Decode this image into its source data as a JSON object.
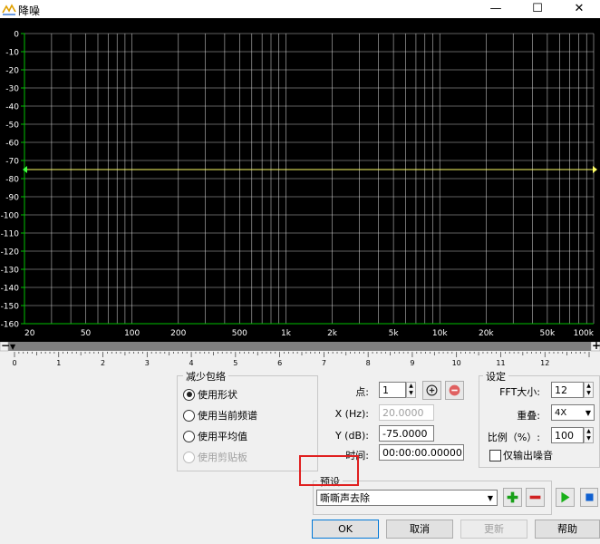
{
  "window": {
    "title": "降噪",
    "minimize": "—",
    "maximize": "☐",
    "close": "✕"
  },
  "chart_data": {
    "type": "line",
    "x_tick_labels": [
      "20",
      "50",
      "100",
      "200",
      "500",
      "1k",
      "2k",
      "5k",
      "10k",
      "20k",
      "50k",
      "100k"
    ],
    "y_tick_labels": [
      "0",
      "-10",
      "-20",
      "-30",
      "-40",
      "-50",
      "-60",
      "-70",
      "-80",
      "-90",
      "-100",
      "-110",
      "-120",
      "-130",
      "-140",
      "-150",
      "-160"
    ],
    "series": [
      {
        "x": [
          20,
          100000
        ],
        "y": [
          -75,
          -75
        ]
      }
    ],
    "xscale": "log",
    "xlim": [
      20,
      100000
    ],
    "ylim": [
      -160,
      0
    ],
    "grid": true,
    "line_color": "#ffff66",
    "grid_color": "#e0e0e0",
    "axis_color": "#00c000"
  },
  "ruler": {
    "labels": [
      "0",
      "1",
      "2",
      "3",
      "4",
      "5",
      "6",
      "7",
      "8",
      "9",
      "10",
      "11",
      "12"
    ]
  },
  "reduce_envelope": {
    "legend": "减少包络",
    "options": [
      "使用形状",
      "使用当前频谱",
      "使用平均值",
      "使用剪贴板"
    ],
    "selected": 0
  },
  "point": {
    "point_label": "点:",
    "point_value": "1",
    "x_label": "X (Hz):",
    "x_value": "20.0000",
    "y_label": "Y (dB):",
    "y_value": "-75.0000",
    "time_label": "时间:",
    "time_value": "00:00:00.00000"
  },
  "settings": {
    "legend": "设定",
    "fft_label": "FFT大小:",
    "fft_value": "12",
    "overlap_label": "重叠:",
    "overlap_value": "4X",
    "ratio_label": "比例（%）:",
    "ratio_value": "100",
    "noise_only_label": "仅输出噪音"
  },
  "preset": {
    "legend": "预设",
    "value": "嘶嘶声去除"
  },
  "buttons": {
    "ok": "OK",
    "cancel": "取消",
    "update": "更新",
    "help": "帮助"
  }
}
